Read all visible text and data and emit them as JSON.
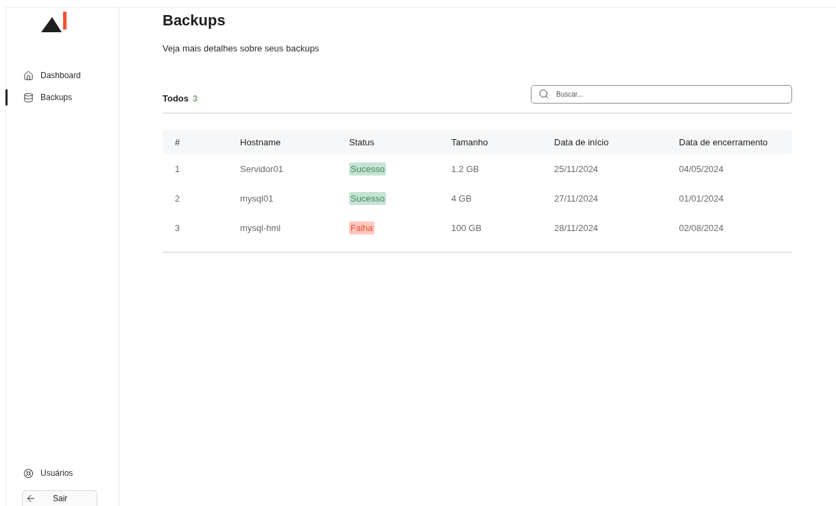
{
  "sidebar": {
    "nav": [
      {
        "label": "Dashboard",
        "selected": false
      },
      {
        "label": "Backups",
        "selected": true
      }
    ],
    "footer_items": [
      {
        "label": "Usuários"
      }
    ],
    "logout_button": "Sair"
  },
  "page": {
    "title": "Backups",
    "subtitle": "Veja mais detalhes sobre seus backups"
  },
  "filter": {
    "label": "Todos",
    "count": "3"
  },
  "search": {
    "placeholder": "Buscar..."
  },
  "table": {
    "columns": [
      "#",
      "Hostname",
      "Status",
      "Tamanho",
      "Data de início",
      "Data de encerramento"
    ],
    "rows": [
      {
        "index": "1",
        "hostname": "Servidor01",
        "status": {
          "label": "Sucesso",
          "kind": "success"
        },
        "size": "1.2 GB",
        "start": "25/11/2024",
        "end": "04/05/2024"
      },
      {
        "index": "2",
        "hostname": "mysql01",
        "status": {
          "label": "Sucesso",
          "kind": "success"
        },
        "size": "4 GB",
        "start": "27/11/2024",
        "end": "01/01/2024"
      },
      {
        "index": "3",
        "hostname": "mysql-hml",
        "status": {
          "label": "Falha",
          "kind": "failure"
        },
        "size": "100 GB",
        "start": "28/11/2024",
        "end": "02/08/2024"
      }
    ]
  }
}
